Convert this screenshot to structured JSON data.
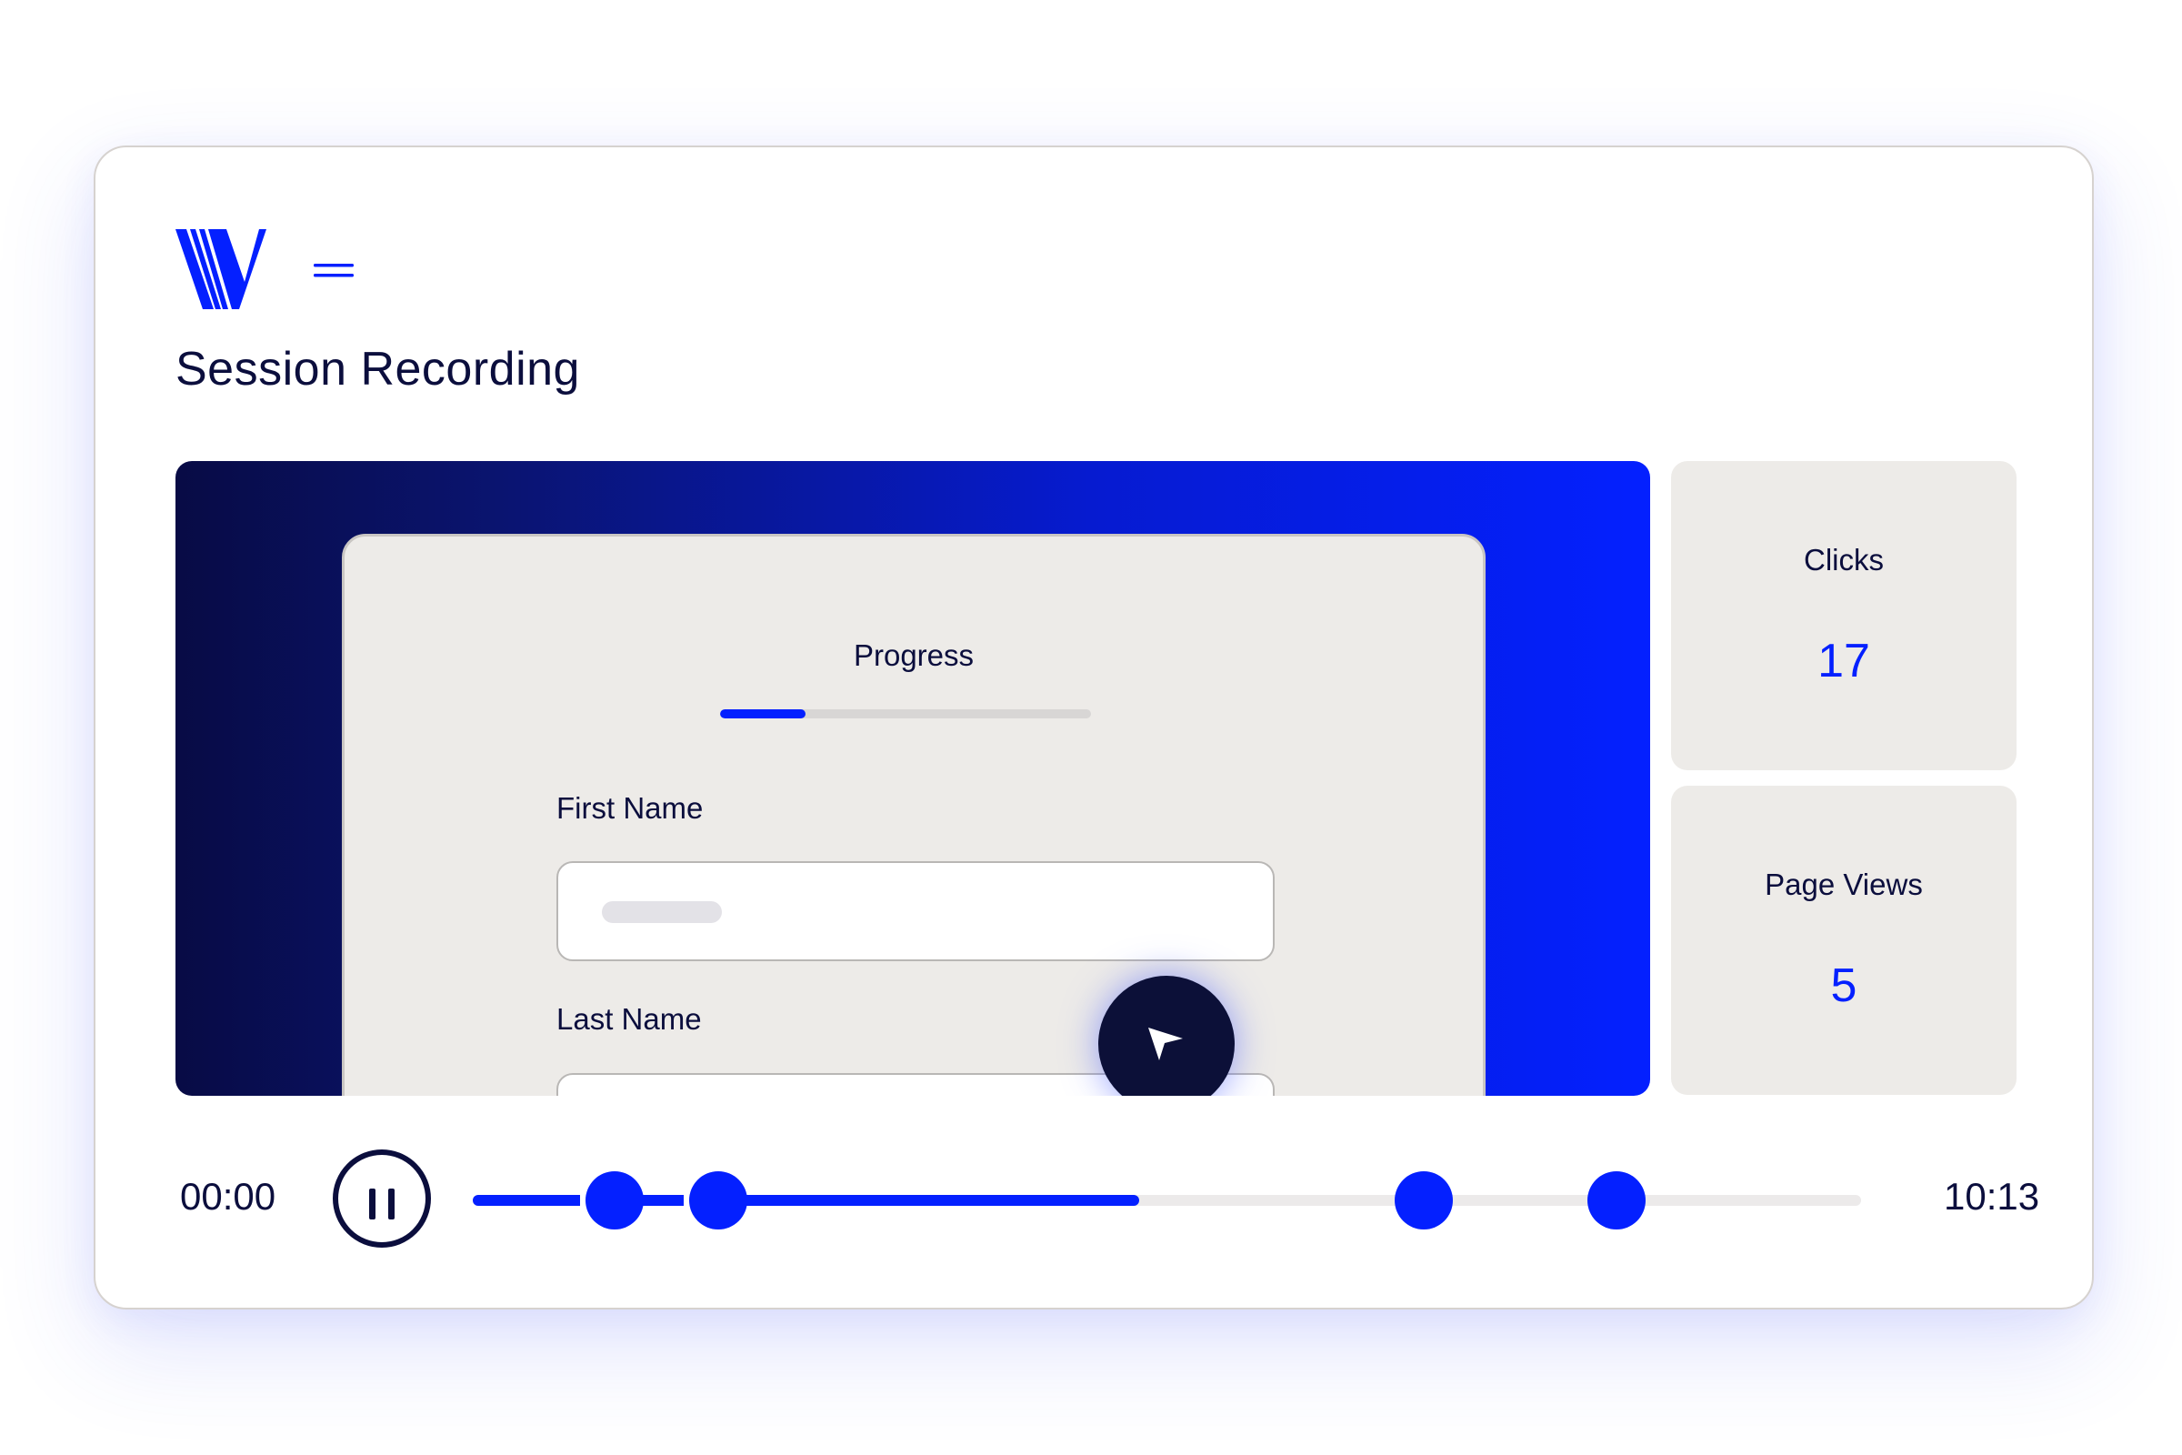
{
  "brand": {
    "logo": "v-stripes-logo",
    "accent_color": "#0420ff",
    "dark_color": "#0b0e3d"
  },
  "header": {
    "menu_icon": "menu-icon",
    "title": "Session Recording"
  },
  "recording": {
    "form": {
      "progress_label": "Progress",
      "progress_fraction": 0.23,
      "first_name_label": "First Name",
      "last_name_label": "Last Name"
    },
    "cursor_icon": "cursor-arrow-icon"
  },
  "stats": [
    {
      "label": "Clicks",
      "value": "17"
    },
    {
      "label": "Page Views",
      "value": "5"
    }
  ],
  "playback": {
    "start_time": "00:00",
    "end_time": "10:13",
    "pause_icon": "pause-icon",
    "played_fraction": 0.48,
    "event_markers": [
      0.102,
      0.177,
      0.685,
      0.824
    ]
  }
}
